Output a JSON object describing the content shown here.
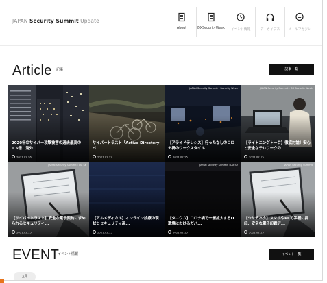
{
  "header": {
    "site_title_prefix": "JAPAN",
    "site_title_bold": "Security Summit",
    "site_title_suffix": "Update",
    "nav": [
      {
        "label": "About",
        "icon": "book-icon"
      },
      {
        "label": "DXSecurityWeek",
        "icon": "book-icon"
      },
      {
        "label": "イベント情報",
        "icon": "clock-icon"
      },
      {
        "label": "アーカイブス",
        "icon": "headphones-icon"
      },
      {
        "label": "メールマガジン",
        "icon": "chat-icon"
      }
    ]
  },
  "article": {
    "title": "Article",
    "subtitle": "記事",
    "button": "記事一覧",
    "cards": [
      {
        "title": "2020年のサイバー攻撃被害の過去最高の1.6倍、海外...",
        "date": "2021.02.26",
        "ribbon": ""
      },
      {
        "title": "サイバートラスト「Active Directory ペ...",
        "date": "2021.02.22",
        "ribbon": ""
      },
      {
        "title": "【アライドテレシス】行ったなしのコロナ禍のワークスタイル...",
        "date": "2021.02.15",
        "ribbon": "JAPAN Security Summit : Security Week"
      },
      {
        "title": "【ライトニングトーク】徹底討論！安心と安全なテレワークの...",
        "date": "2021.02.15",
        "ribbon": "JAPAN Security Summit : DX Security Week"
      },
      {
        "title": "【サイバートラスト】安全な電子契約に求められるセキュリティ...",
        "date": "2021.02.15",
        "ribbon": "JAPAN Security Summit : DX Se"
      },
      {
        "title": "【アルメディカル】オンライン診療の現状とセキュリティ画...",
        "date": "2021.02.15",
        "ribbon": ""
      },
      {
        "title": "【タニウム】コロナ禍で一層拡大するIT環境におけるガバ...",
        "date": "2021.02.15",
        "ribbon": "JAPAN Security Summit : DX Se"
      },
      {
        "title": "【シヤチハタ】スマホやPCで手軽に押印、安全な電子印鑑ア...",
        "date": "2021.02.15",
        "ribbon": "JAPAN Security Summit"
      }
    ]
  },
  "event": {
    "title": "EVENT",
    "subtitle": "イベント情報",
    "button": "イベント一覧",
    "month_tab": "3月"
  },
  "colors": {
    "accent": "#e8741c",
    "button_bg": "#111111",
    "grid_bg": "#111111"
  }
}
